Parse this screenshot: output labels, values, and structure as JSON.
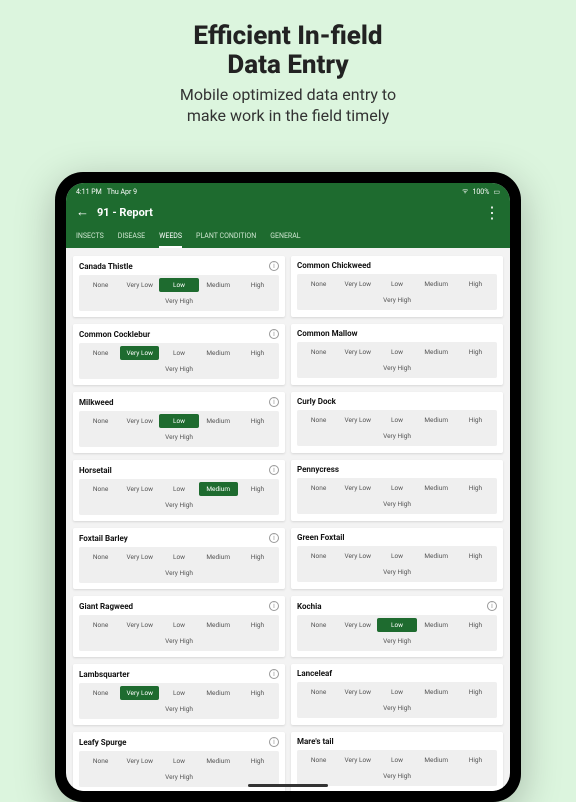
{
  "promo": {
    "title_line1": "Efficient In-field",
    "title_line2": "Data Entry",
    "sub_line1": "Mobile optimized data entry to",
    "sub_line2": "make work in the field timely"
  },
  "statusbar": {
    "time": "4:11 PM",
    "date": "Thu Apr 9",
    "battery": "100%"
  },
  "appbar": {
    "title": "91 - Report",
    "menu_count": "⋮"
  },
  "tabs": [
    {
      "label": "INSECTS",
      "active": false
    },
    {
      "label": "DISEASE",
      "active": false
    },
    {
      "label": "WEEDS",
      "active": true
    },
    {
      "label": "PLANT CONDITION",
      "active": false
    },
    {
      "label": "GENERAL",
      "active": false
    }
  ],
  "levels": [
    "None",
    "Very Low",
    "Low",
    "Medium",
    "High",
    "Very High"
  ],
  "weeds": [
    {
      "name": "Canada Thistle",
      "info": true,
      "selected": "Low"
    },
    {
      "name": "Common Chickweed",
      "info": false,
      "selected": null
    },
    {
      "name": "Common Cocklebur",
      "info": true,
      "selected": "Very Low"
    },
    {
      "name": "Common Mallow",
      "info": false,
      "selected": null
    },
    {
      "name": "Milkweed",
      "info": true,
      "selected": "Low"
    },
    {
      "name": "Curly Dock",
      "info": false,
      "selected": null
    },
    {
      "name": "Horsetail",
      "info": true,
      "selected": "Medium"
    },
    {
      "name": "Pennycress",
      "info": false,
      "selected": null
    },
    {
      "name": "Foxtail Barley",
      "info": true,
      "selected": null
    },
    {
      "name": "Green Foxtail",
      "info": false,
      "selected": null
    },
    {
      "name": "Giant Ragweed",
      "info": true,
      "selected": null
    },
    {
      "name": "Kochia",
      "info": true,
      "selected": "Low"
    },
    {
      "name": "Lambsquarter",
      "info": true,
      "selected": "Very Low"
    },
    {
      "name": "Lanceleaf",
      "info": false,
      "selected": null
    },
    {
      "name": "Leafy Spurge",
      "info": true,
      "selected": null
    },
    {
      "name": "Mare's tail",
      "info": false,
      "selected": null
    }
  ]
}
